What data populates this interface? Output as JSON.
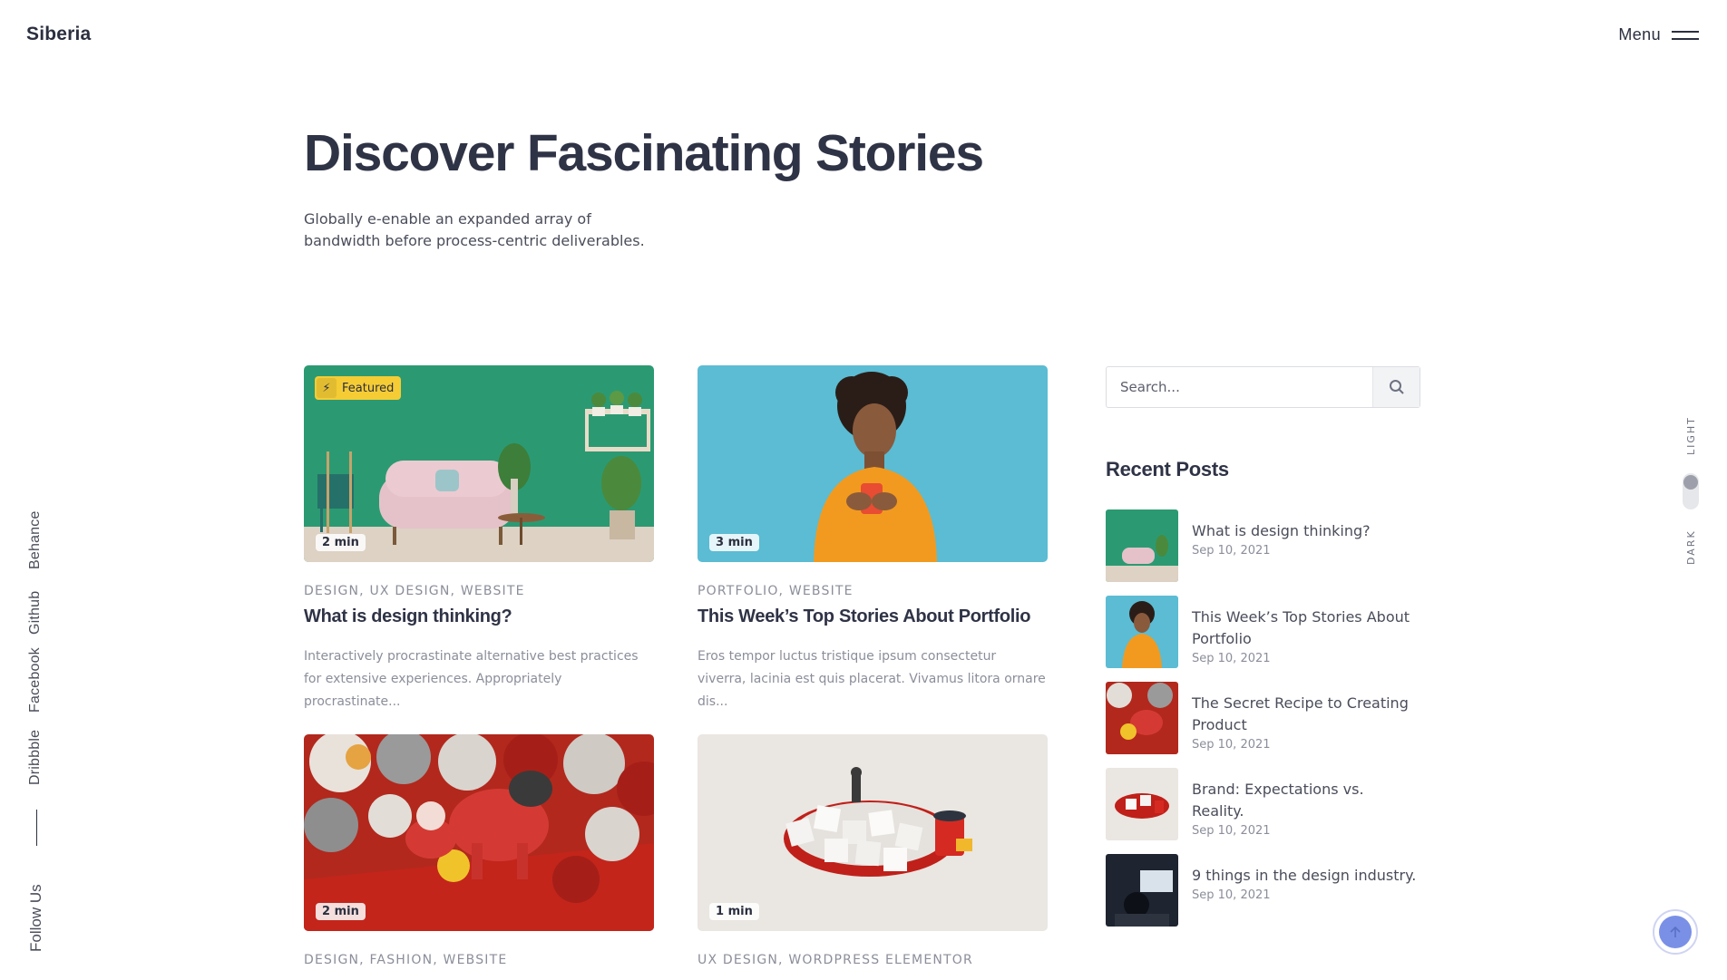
{
  "header": {
    "logo": "Siberia",
    "menu_label": "Menu"
  },
  "hero": {
    "title": "Discover Fascinating Stories",
    "subtitle": "Globally e-enable an expanded array of bandwidth before process-centric deliverables."
  },
  "social": {
    "items": [
      "Behance",
      "Github",
      "Facebook",
      "Dribbble"
    ],
    "follow_label": "Follow Us"
  },
  "cards": [
    {
      "featured": "Featured",
      "read_time": "2 min",
      "categories": "DESIGN, UX DESIGN, WEBSITE",
      "title": "What is design thinking?",
      "excerpt": "Interactively procrastinate alternative best practices for extensive experiences. Appropriately procrastinate..."
    },
    {
      "read_time": "3 min",
      "categories": "PORTFOLIO, WEBSITE",
      "title": "This Week’s Top Stories About Portfolio",
      "excerpt": "Eros tempor luctus tristique ipsum consectetur viverra, lacinia est quis placerat. Vivamus litora ornare dis..."
    },
    {
      "read_time": "2 min",
      "categories": "DESIGN, FASHION, WEBSITE"
    },
    {
      "read_time": "1 min",
      "categories": "UX DESIGN, WORDPRESS ELEMENTOR"
    }
  ],
  "sidebar": {
    "search_placeholder": "Search...",
    "recent_title": "Recent Posts",
    "recent_posts": [
      {
        "title": "What is design thinking?",
        "date": "Sep 10, 2021"
      },
      {
        "title": "This Week’s Top Stories About Portfolio",
        "date": "Sep 10, 2021"
      },
      {
        "title": "The Secret Recipe to Creating Product",
        "date": "Sep 10, 2021"
      },
      {
        "title": "Brand: Expectations vs. Reality.",
        "date": "Sep 10, 2021"
      },
      {
        "title": "9 things in the design industry.",
        "date": "Sep 10, 2021"
      }
    ]
  },
  "theme": {
    "light_label": "LIGHT",
    "dark_label": "DARK",
    "selected": "light"
  },
  "colors": {
    "accent_yellow": "#f6cc35",
    "scroll_top": "#7a90e6",
    "text_dark": "#2f3346"
  }
}
